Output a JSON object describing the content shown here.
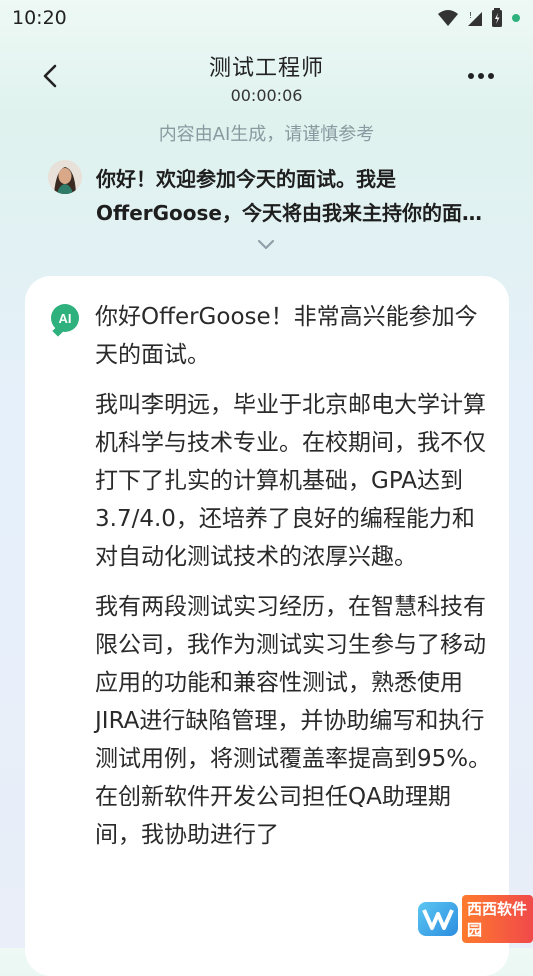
{
  "status_bar": {
    "time": "10:20",
    "icons": [
      "wifi-icon",
      "signal-icon",
      "battery-icon",
      "notification-dot-icon"
    ],
    "dot_color": "#2fb17d"
  },
  "header": {
    "title": "测试工程师",
    "timer": "00:00:06",
    "back_icon": "chevron-left-icon",
    "more_icon": "more-horizontal-icon"
  },
  "disclaimer": "内容由AI生成，请谨慎参考",
  "interviewer_message": {
    "text": "你好！欢迎参加今天的面试。我是OfferGoose，今天将由我来主持你的面试。"
  },
  "expand_icon": "chevron-down-icon",
  "answer_card": {
    "badge_label": "AI",
    "paragraphs": [
      "你好OfferGoose！非常高兴能参加今天的面试。",
      "我叫李明远，毕业于北京邮电大学计算机科学与技术专业。在校期间，我不仅打下了扎实的计算机基础，GPA达到3.7/4.0，还培养了良好的编程能力和对自动化测试技术的浓厚兴趣。",
      "我有两段测试实习经历，在智慧科技有限公司，我作为测试实习生参与了移动应用的功能和兼容性测试，熟悉使用JIRA进行缺陷管理，并协助编写和执行测试用例，将测试覆盖率提高到95%。在创新软件开发公司担任QA助理期间，我协助进行了"
    ]
  },
  "watermark": {
    "text": "西西软件园",
    "logo_color": "#2b8de0"
  }
}
